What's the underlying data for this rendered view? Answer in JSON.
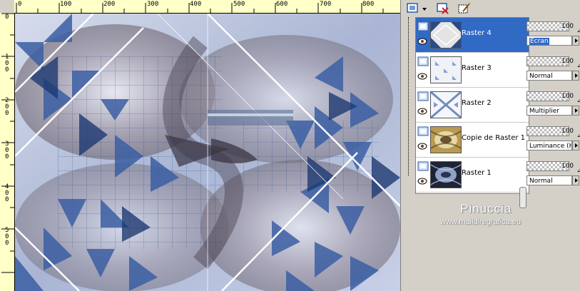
{
  "rulers": {
    "top": [
      "0",
      "100",
      "200",
      "300",
      "400",
      "500",
      "600",
      "700",
      "800"
    ],
    "left": [
      "0",
      "100",
      "200",
      "300",
      "400",
      "500"
    ]
  },
  "layers_panel": {
    "layers": [
      {
        "name": "Raster 4",
        "selected": true,
        "opacity": "100",
        "blend": "Ecran",
        "blend_highlight": true
      },
      {
        "name": "Raster 3",
        "selected": false,
        "opacity": "100",
        "blend": "Normal"
      },
      {
        "name": "Raster 2",
        "selected": false,
        "opacity": "100",
        "blend": "Multiplier"
      },
      {
        "name": "Copie de Raster 1",
        "selected": false,
        "opacity": "100",
        "blend": "Luminance (H)"
      },
      {
        "name": "Raster 1",
        "selected": false,
        "opacity": "100",
        "blend": "Normal"
      }
    ],
    "icons": [
      "new-layer-icon",
      "delete-layer-icon",
      "edit-mask-icon"
    ]
  },
  "watermark": {
    "name": "Pinuccia",
    "url": "www.maildiregrafica.eu"
  },
  "colors": {
    "selected": "#316ac5",
    "canvas_blue": "#3b5fa3",
    "canvas_light": "#c9d3e8"
  }
}
